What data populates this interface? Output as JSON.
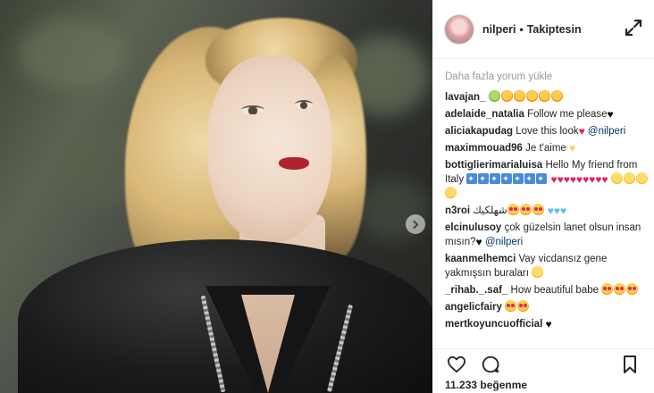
{
  "header": {
    "username": "nilperi",
    "separator": "•",
    "follow_status": "Takiptesin"
  },
  "comments": {
    "load_more": "Daha fazla yorum yükle",
    "items": [
      {
        "user": "lavajan_",
        "text": ""
      },
      {
        "user": "adelaide_natalia",
        "text": "Follow me please"
      },
      {
        "user": "aliciakapudag",
        "text": "Love this look",
        "mention": "@nilperi"
      },
      {
        "user": "maximmouad96",
        "text": "Je t'aime"
      },
      {
        "user": "bottiglierimarialuisa",
        "text": "Hello My friend from Italy"
      },
      {
        "user": "n3roi",
        "text": "شهلكيك"
      },
      {
        "user": "elcinulusoy",
        "text": "çok güzelsin lanet olsun insan mısın?",
        "mention": "@nilperi"
      },
      {
        "user": "kaanmelhemci",
        "text": "Vay vicdansız gene yakmışsın buraları"
      },
      {
        "user": "_rihab._.saf_",
        "text": "How beautiful babe"
      },
      {
        "user": "angelicfairy",
        "text": ""
      },
      {
        "user": "mertkoyuncuofficial",
        "text": ""
      }
    ]
  },
  "actions": {
    "likes": "11.233 beğenme"
  },
  "icons": {
    "expand": "expand-arrows-icon",
    "like": "heart-outline-icon",
    "comment": "comment-bubble-icon",
    "save": "bookmark-icon",
    "next": "chevron-right-icon"
  },
  "colors": {
    "mention": "#003569",
    "muted": "#999999",
    "border": "#efefef"
  }
}
